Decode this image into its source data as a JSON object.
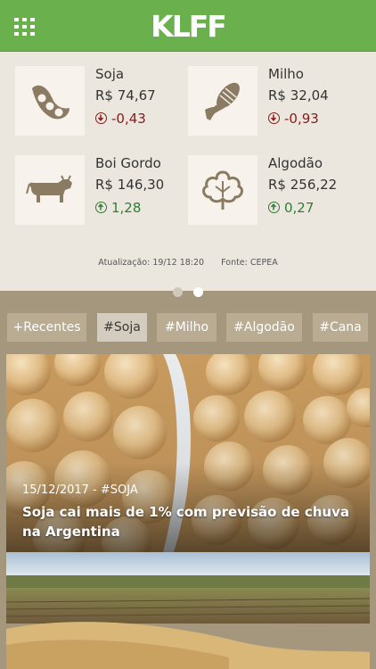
{
  "header": {
    "brand": "KLFF",
    "menu_icon": "grid-menu-icon",
    "background": "#6ab04c"
  },
  "quotes": [
    {
      "name": "Soja",
      "price": "R$ 74,67",
      "change": "-0,43",
      "direction": "down",
      "icon": "soy-pod-icon"
    },
    {
      "name": "Milho",
      "price": "R$ 32,04",
      "change": "-0,93",
      "direction": "down",
      "icon": "corn-icon"
    },
    {
      "name": "Boi Gordo",
      "price": "R$ 146,30",
      "change": "1,28",
      "direction": "up",
      "icon": "cattle-icon"
    },
    {
      "name": "Algodão",
      "price": "R$ 256,22",
      "change": "0,27",
      "direction": "up",
      "icon": "cotton-icon"
    }
  ],
  "update": {
    "timestamp": "Atualização: 19/12 18:20",
    "source": "Fonte: CEPEA"
  },
  "carousel": {
    "pages": 2,
    "active_index": 1
  },
  "tags": [
    {
      "label": "+Recentes",
      "active": false
    },
    {
      "label": "#Soja",
      "active": true
    },
    {
      "label": "#Milho",
      "active": false
    },
    {
      "label": "#Algodão",
      "active": false
    },
    {
      "label": "#Cana",
      "active": false
    }
  ],
  "articles": [
    {
      "meta": "15/12/2017 - #SOJA",
      "headline": "Soja cai mais de 1% com previsão de chuva na Argentina"
    }
  ],
  "colors": {
    "negative": "#8b1a1a",
    "positive": "#2e7d32",
    "icon": "#8b7b62",
    "news_background": "#a4977d"
  }
}
